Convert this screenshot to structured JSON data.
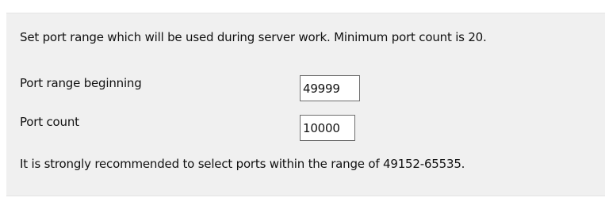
{
  "panel": {
    "intro_text": "Set port range which will be used during server work. Minimum port count is 20.",
    "fields": [
      {
        "label": "Port range beginning",
        "value": "49999"
      },
      {
        "label": "Port count",
        "value": "10000"
      }
    ],
    "note_text": "It is strongly recommended to select ports within the range of 49152-65535."
  }
}
